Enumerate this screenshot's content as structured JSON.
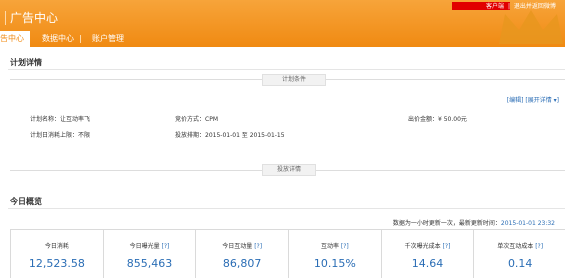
{
  "header": {
    "brand": "广告中心",
    "top_links": [
      "客户端",
      "|",
      "退出并返回微博"
    ],
    "nav": {
      "active": "告中心",
      "items": [
        "数据中心",
        "账户管理"
      ]
    }
  },
  "plan": {
    "title": "计划详情",
    "tab_conditions": "计划条件",
    "links": [
      "[编辑]",
      "[展开详情 ▾]"
    ],
    "name_label": "计划名称：",
    "name_value": "让互动率飞",
    "pricing_label": "竞价方式：",
    "pricing_value": "CPM",
    "bid_label": "出价金额：",
    "bid_value": "¥ 50.00元",
    "daily_cap_label": "计划日消耗上限：",
    "daily_cap_value": "不限",
    "schedule_label": "投放排期：",
    "schedule_value": "2015-01-01 至 2015-01-15",
    "tab_details": "投放详情"
  },
  "today": {
    "title": "今日概览",
    "note": "数据为一小时更新一次，最新更新时间：",
    "timestamp": "2015-01-01 23:32",
    "metrics": [
      {
        "label": "今日消耗",
        "q": "",
        "value": "12,523.58"
      },
      {
        "label": "今日曝光量",
        "q": "[?]",
        "value": "855,463"
      },
      {
        "label": "今日互动量",
        "q": "[?]",
        "value": "86,807"
      },
      {
        "label": "互动率",
        "q": "[?]",
        "value": "10.15%"
      },
      {
        "label": "千次曝光成本",
        "q": "[?]",
        "value": "14.64"
      },
      {
        "label": "单次互动成本",
        "q": "[?]",
        "value": "0.14"
      }
    ]
  },
  "colors": {
    "accent": "#f08a12",
    "link": "#2a6db5"
  }
}
